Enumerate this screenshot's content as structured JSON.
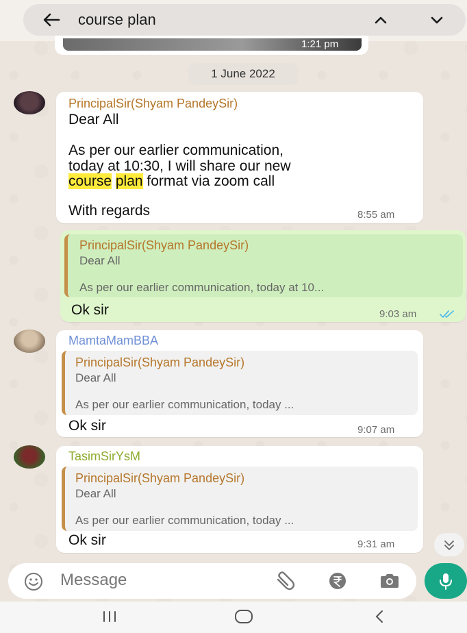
{
  "search": {
    "query": "course plan"
  },
  "top_image": {
    "time": "1:21 pm"
  },
  "date_chip": "1 June 2022",
  "messages": [
    {
      "sender": "PrincipalSir(Shyam PandeySir)",
      "sender_color": "#b5762a",
      "line1": "Dear All",
      "line2": "As per our earlier communication,",
      "line3": "today at 10:30, I will share our new",
      "line4_pre": "",
      "hl1": "course",
      "line4_mid": " ",
      "hl2": "plan",
      "line4_post": " format via zoom call",
      "line5": "With regards",
      "time": "8:55 am"
    },
    {
      "quoted_sender": "PrincipalSir(Shyam PandeySir)",
      "quoted_line1": "Dear All",
      "quoted_line2": "As per our earlier communication, today at 10...",
      "text": "Ok sir",
      "time": "9:03 am"
    },
    {
      "sender": "MamtaMamBBA",
      "sender_color": "#6f8fd6",
      "quoted_sender": "PrincipalSir(Shyam PandeySir)",
      "quoted_line1": "Dear All",
      "quoted_line2": "As per our earlier communication, today ...",
      "text": "Ok sir",
      "time": "9:07 am"
    },
    {
      "sender": "TasimSirYsM",
      "sender_color": "#8cab2f",
      "quoted_sender": "PrincipalSir(Shyam PandeySir)",
      "quoted_line1": "Dear All",
      "quoted_line2": "As per our earlier communication, today ...",
      "text": "Ok sir",
      "time": "9:31 am"
    }
  ],
  "composer": {
    "placeholder": "Message"
  },
  "colors": {
    "accent": "#18a888",
    "outgoing_bubble": "#dff6cc",
    "highlight": "#ffeb3b",
    "read_ticks": "#53bdeb"
  },
  "icons": [
    "back-arrow-icon",
    "chevron-up-icon",
    "chevron-down-icon",
    "double-tick-icon",
    "scroll-down-icon",
    "emoji-icon",
    "attach-icon",
    "rupee-icon",
    "camera-icon",
    "mic-icon",
    "nav-recents-icon",
    "nav-home-icon",
    "nav-back-icon"
  ]
}
